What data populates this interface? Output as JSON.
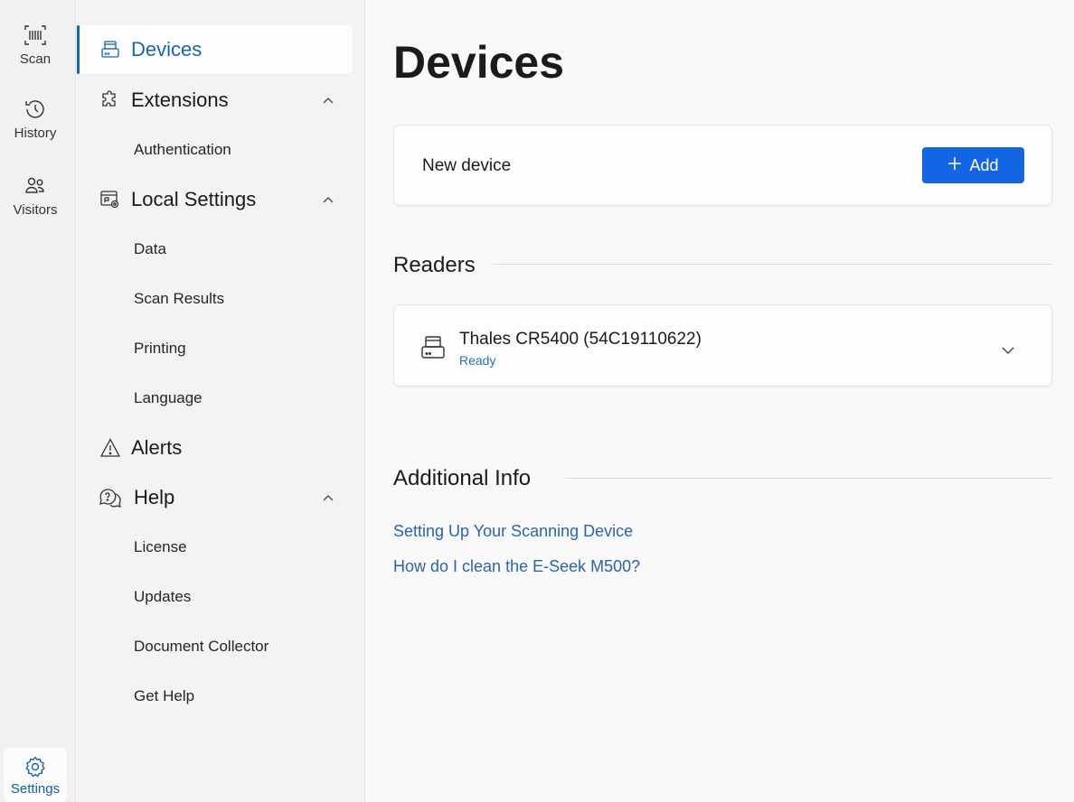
{
  "rail": {
    "items": [
      {
        "label": "Scan",
        "icon": "barcode-icon"
      },
      {
        "label": "History",
        "icon": "history-icon"
      },
      {
        "label": "Visitors",
        "icon": "visitors-icon"
      },
      {
        "label": "Settings",
        "icon": "gear-icon"
      }
    ]
  },
  "nav": {
    "devices": "Devices",
    "extensions": "Extensions",
    "extensions_sub": [
      "Authentication"
    ],
    "local_settings": "Local Settings",
    "local_settings_sub": [
      "Data",
      "Scan Results",
      "Printing",
      "Language"
    ],
    "alerts": "Alerts",
    "help": "Help",
    "help_sub": [
      "License",
      "Updates",
      "Document Collector",
      "Get Help"
    ]
  },
  "main": {
    "title": "Devices",
    "new_device_label": "New device",
    "add_button": "Add",
    "readers_heading": "Readers",
    "reader": {
      "name": "Thales CR5400 (54C19110622)",
      "status": "Ready"
    },
    "additional_heading": "Additional Info",
    "links": [
      "Setting Up Your Scanning Device",
      "How do I clean the E-Seek M500?"
    ]
  },
  "colors": {
    "accent": "#1266e6",
    "active_text": "#1a63b0",
    "link": "#2a64b0"
  }
}
